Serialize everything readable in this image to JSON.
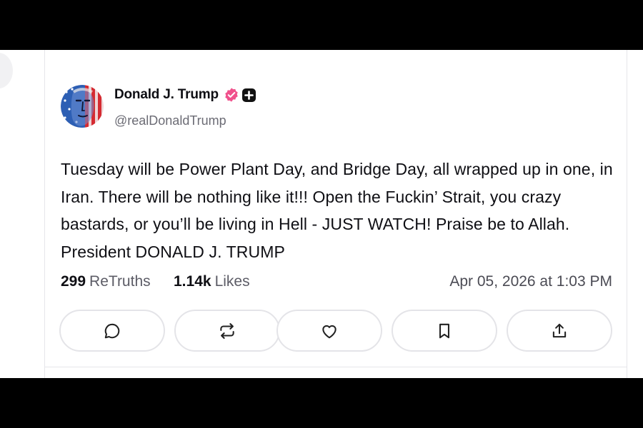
{
  "author": {
    "name": "Donald J. Trump",
    "handle": "@realDonaldTrump",
    "verified_color": "#f0518c"
  },
  "post": {
    "text": "Tuesday will be Power Plant Day, and Bridge Day, all wrapped up in one, in Iran. There will be nothing like it!!! Open the Fuckin’ Strait, you crazy bastards, or you’ll be living in Hell - JUST WATCH! Praise be to Allah. President DONALD J. TRUMP"
  },
  "stats": {
    "retruths_count": "299",
    "retruths_label": "ReTruths",
    "likes_count": "1.14k",
    "likes_label": "Likes",
    "timestamp": "Apr 05, 2026 at 1:03 PM"
  },
  "actions": [
    {
      "icon": "reply-icon"
    },
    {
      "icon": "retruth-icon"
    },
    {
      "icon": "like-icon"
    },
    {
      "icon": "bookmark-icon"
    },
    {
      "icon": "share-icon"
    }
  ],
  "colors": {
    "text": "#0f0f14",
    "muted": "#6b6b74",
    "border": "#e4e4e8",
    "background": "#ffffff",
    "letterbox": "#000000"
  }
}
